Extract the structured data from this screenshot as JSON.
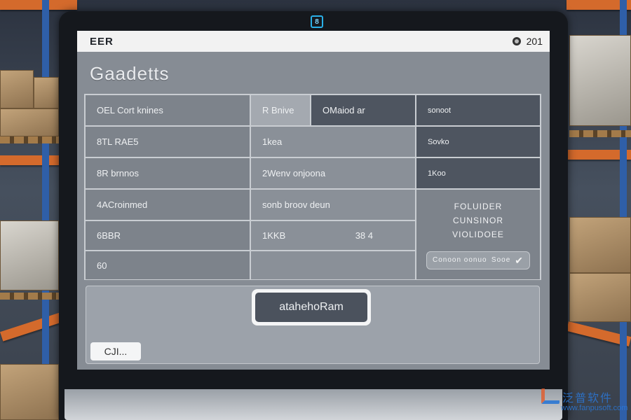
{
  "window": {
    "brand": "EER",
    "topright_text": "201",
    "camera_label": "8"
  },
  "page": {
    "title": "Gaadetts"
  },
  "grid": {
    "col1": [
      "OEL Cort knines",
      "8TL RAE5",
      "8R brnnos",
      "4ACroinmed",
      "6BBR",
      "60"
    ],
    "col2a": [
      "R Bnive",
      "1kea",
      "2Wenv onjoona",
      "sonb broov deun",
      "1KKB",
      ""
    ],
    "col2b_header": "OMaiod ar",
    "col2_extra": "38 4",
    "col3": [
      "sonoot",
      "Sovko",
      "1Koo"
    ]
  },
  "side_panel": {
    "lines": [
      "FOLUIDER",
      "CUNSINOR",
      "VIOLIDOEE"
    ],
    "pill_left": "Conoon oonuo",
    "pill_right": "Sooe"
  },
  "actions": {
    "main_button": "atahehoRam",
    "small_button": "CJI..."
  },
  "watermark": {
    "cn": "泛普软件",
    "url": "www.fanpusoft.com"
  }
}
